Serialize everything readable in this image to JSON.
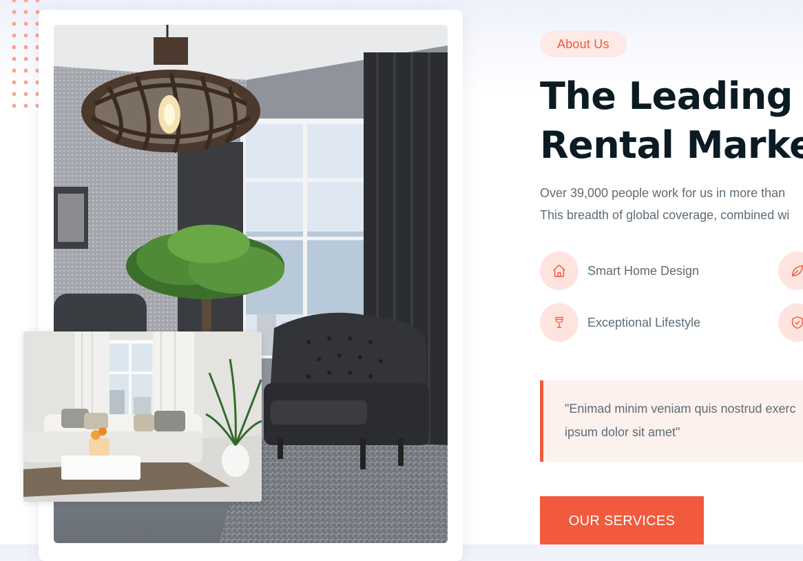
{
  "about": {
    "badge": "About Us",
    "headline_line1": "The Leading R",
    "headline_line2": "Rental Market",
    "desc_line1": "Over 39,000 people work for us in more than",
    "desc_line2": "This breadth of global coverage, combined wi"
  },
  "features": [
    {
      "label": "Smart Home Design",
      "icon": "home-icon"
    },
    {
      "label": "Exceptional Lifestyle",
      "icon": "glass-icon"
    },
    {
      "label": "",
      "icon": "leaf-icon"
    },
    {
      "label": "",
      "icon": "shield-check-icon"
    }
  ],
  "quote": {
    "line1": "\"Enimad minim veniam quis nostrud exerc",
    "line2": "ipsum dolor sit amet\""
  },
  "cta": {
    "label": "OUR SERVICES"
  },
  "colors": {
    "accent": "#f15a3d",
    "accent_soft": "#fde4df",
    "heading": "#0b1b24",
    "body_text": "#5f6b74"
  }
}
